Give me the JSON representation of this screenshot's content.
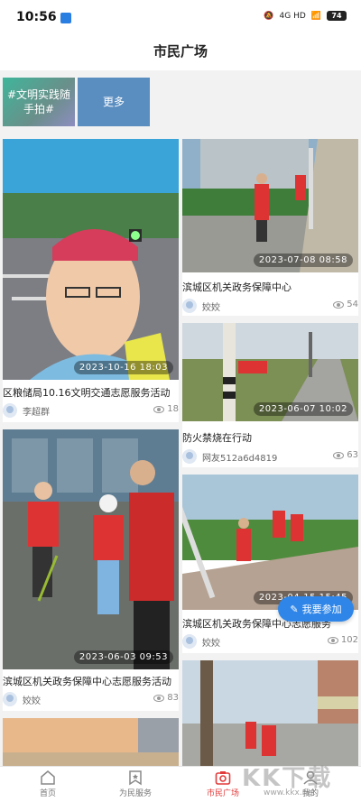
{
  "status": {
    "time": "10:56",
    "network": "4G HD",
    "battery": "74"
  },
  "header": {
    "title": "市民广场"
  },
  "topics": [
    {
      "label": "#文明实践随手拍#"
    },
    {
      "label": "更多"
    }
  ],
  "posts": [
    {
      "title": "区粮储局10.16文明交通志愿服务活动",
      "author": "李超群",
      "views": "18",
      "time": "2023-10-16 18:03"
    },
    {
      "title": "滨城区机关政务保障中心",
      "author": "姣姣",
      "views": "54",
      "time": "2023-07-08 08:58"
    },
    {
      "title": "防火禁烧在行动",
      "author": "网友512a6d4819",
      "views": "63",
      "time": "2023-06-07 10:02"
    },
    {
      "title": "滨城区机关政务保障中心志愿服务活动",
      "author": "姣姣",
      "views": "83",
      "time": "2023-06-03 09:53"
    },
    {
      "title": "滨城区机关政务保障中心志愿服务",
      "author": "姣姣",
      "views": "102",
      "time": "2023-04-15 15:45"
    }
  ],
  "fab": {
    "label": "我要参加"
  },
  "tabbar": [
    {
      "label": "首页"
    },
    {
      "label": "为民服务"
    },
    {
      "label": "市民广场"
    },
    {
      "label": "我的"
    }
  ],
  "watermark": {
    "text": "KK下载",
    "url": "www.kkx.net"
  }
}
